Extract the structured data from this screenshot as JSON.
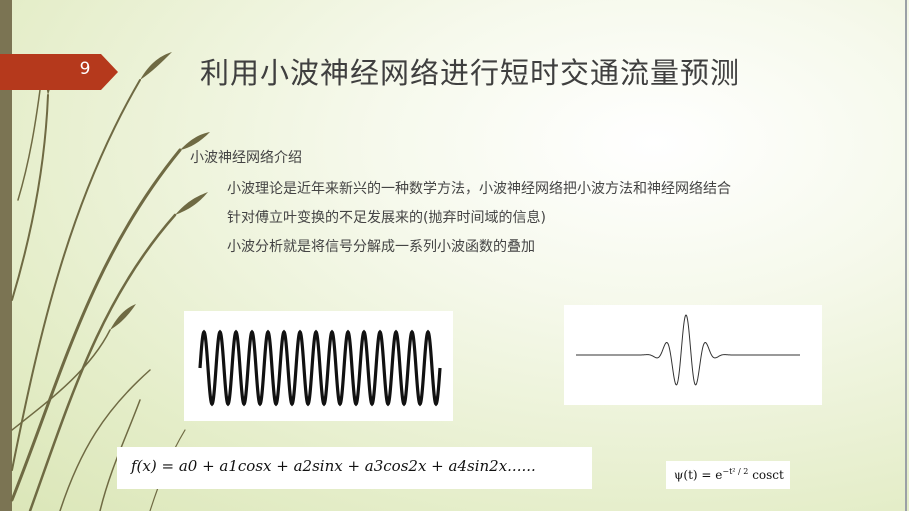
{
  "slide": {
    "number": "9",
    "title": "利用小波神经网络进行短时交通流量预测",
    "bullets": {
      "main": "小波神经网络介绍",
      "sub": [
        "小波理论是近年来新兴的一种数学方法，小波神经网络把小波方法和神经网络结合",
        "针对傅立叶变换的不足发展来的(抛弃时间域的信息)",
        "小波分析就是将信号分解成一系列小波函数的叠加"
      ]
    },
    "formula_fourier": "f(x) = a0 + a1cosx + a2sinx + a3cos2x + a4sin2x......",
    "formula_wavelet": {
      "lhs": "ψ(t) = e",
      "exponent": "−t² / 2",
      "rhs": " cosct"
    }
  },
  "colors": {
    "tag": "#b5391c",
    "left_bar": "#7b7453",
    "stem": "#6f6a43",
    "title_text": "#3f3f3f"
  },
  "icons": {
    "left-stems": "decorative curved leaves/stems",
    "sine-wave": "periodic sine wave image",
    "wavelet": "localized wavelet image"
  }
}
